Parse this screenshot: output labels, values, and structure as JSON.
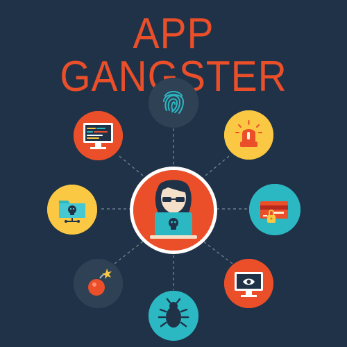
{
  "title": "APP GANGSTER",
  "colors": {
    "background": "#1f3247",
    "accent_red": "#ea4f2a",
    "accent_yellow": "#fbc844",
    "accent_teal": "#2bb8c3",
    "dark_circle": "#2f4255",
    "white": "#ffffff"
  },
  "icons": {
    "center": "hacker-icon",
    "top": "fingerprint-icon",
    "top_right": "alarm-light-icon",
    "right": "credit-card-lock-icon",
    "bottom_right": "monitor-eye-icon",
    "bottom": "bug-icon",
    "bottom_left": "bomb-icon",
    "left": "folder-skull-icon",
    "top_left": "monitor-code-icon"
  }
}
